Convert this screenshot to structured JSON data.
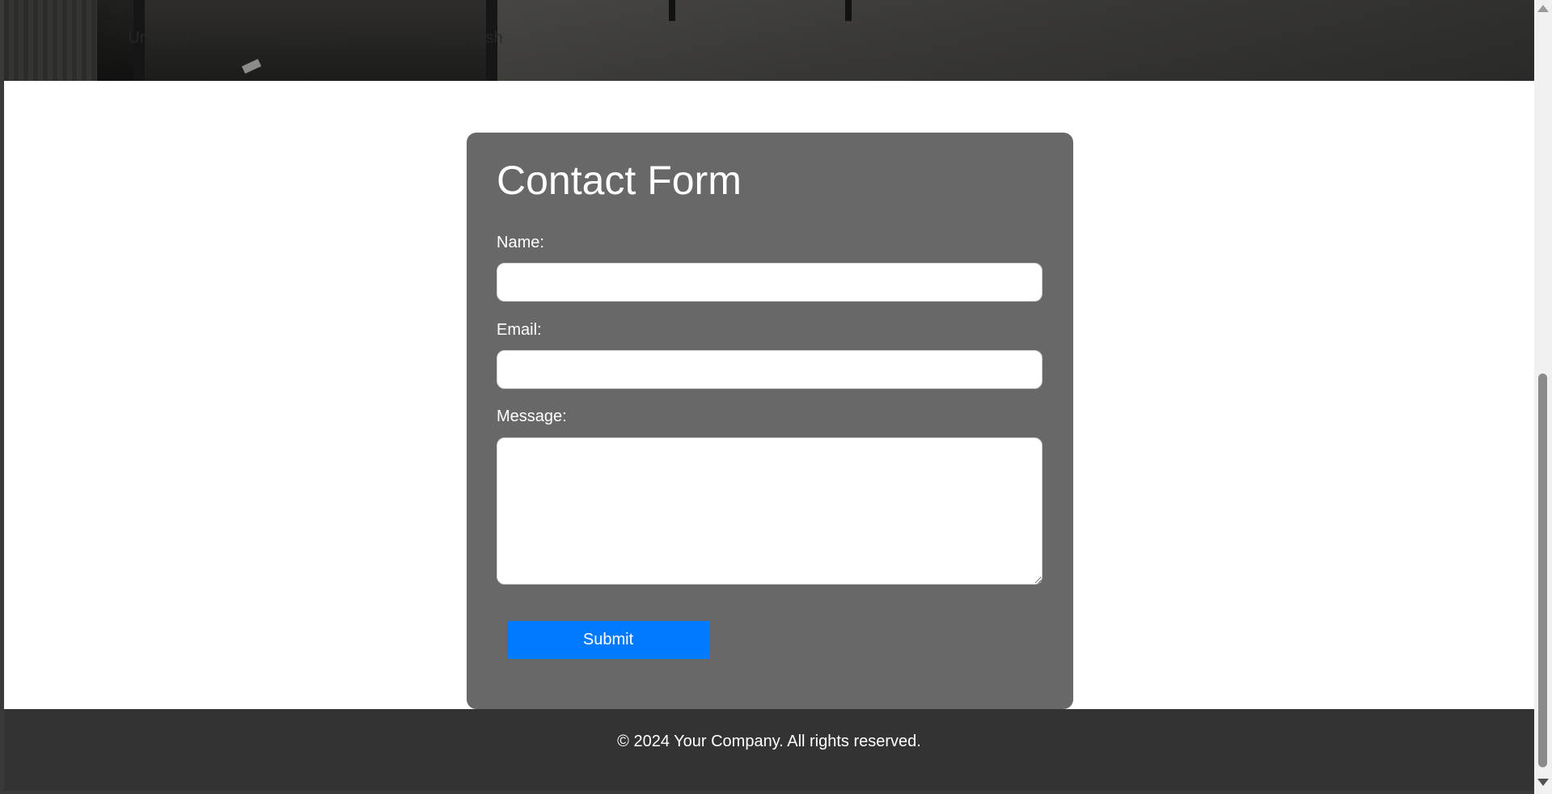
{
  "hero": {
    "nav": [
      {
        "label": "Unsplash"
      },
      {
        "label": "Unsplash"
      },
      {
        "label": "Unsplash"
      }
    ]
  },
  "form": {
    "title": "Contact Form",
    "name_label": "Name:",
    "name_value": "",
    "email_label": "Email:",
    "email_value": "",
    "message_label": "Message:",
    "message_value": "",
    "submit_label": "Submit"
  },
  "footer": {
    "text": "© 2024 Your Company. All rights reserved."
  },
  "colors": {
    "card": "#686868",
    "button": "#007bff",
    "footer": "#333333"
  }
}
